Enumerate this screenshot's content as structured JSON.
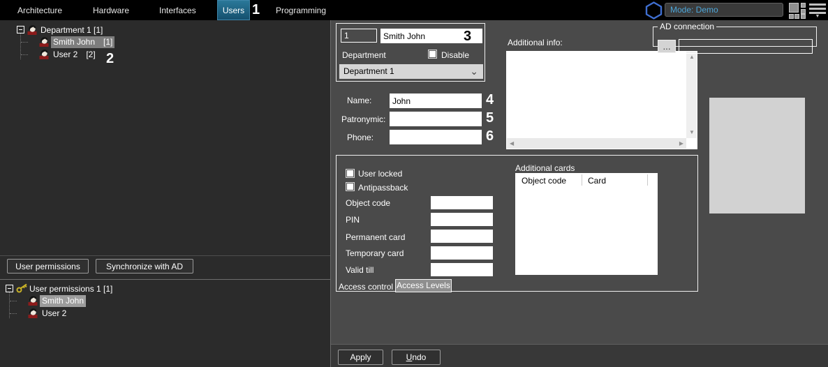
{
  "nav": {
    "items": [
      "Architecture",
      "Hardware",
      "Interfaces",
      "Users",
      "Programming"
    ],
    "mode_text": "Mode: Demo"
  },
  "annotations": {
    "users": "1",
    "smith": "2",
    "fullname": "3",
    "name": "4",
    "patronymic": "5",
    "phone": "6"
  },
  "departments_tree": {
    "root_label": "Department 1 [1]",
    "items": [
      {
        "label": "Smith John",
        "count": "[1]"
      },
      {
        "label": "User 2",
        "count": "[2]"
      }
    ]
  },
  "left_buttons": {
    "user_permissions": "User permissions",
    "synchronize_ad": "Synchronize with AD"
  },
  "permissions_tree": {
    "root_label": "User permissions 1 [1]",
    "items": [
      {
        "label": "Smith John"
      },
      {
        "label": "User 2"
      }
    ]
  },
  "user_form": {
    "id_value": "1",
    "full_name_value": "Smith John",
    "department_label": "Department",
    "disable_label": "Disable",
    "department_value": "Department 1",
    "name_label": "Name:",
    "name_value": "John",
    "patronymic_label": "Patronymic:",
    "patronymic_value": "",
    "phone_label": "Phone:",
    "phone_value": "",
    "additional_info_label": "Additional info:",
    "additional_info_value": "",
    "ad_connection": {
      "legend": "AD connection",
      "browse_label": "...",
      "value": ""
    }
  },
  "access_section": {
    "user_locked_label": "User locked",
    "antipassback_label": "Antipassback",
    "fields": [
      {
        "label": "Object code",
        "value": ""
      },
      {
        "label": "PIN",
        "value": ""
      },
      {
        "label": "Permanent card",
        "value": ""
      },
      {
        "label": "Temporary card",
        "value": ""
      },
      {
        "label": "Valid till",
        "value": ""
      }
    ],
    "additional_cards_label": "Additional cards",
    "cards_columns": [
      "Object code",
      "Card"
    ],
    "tabs": [
      "Access control",
      "Access Levels"
    ]
  },
  "footer": {
    "apply_label": "Apply",
    "undo_label": "Undo"
  },
  "icons": {
    "chevron_down": "⌄",
    "scroll_up": "▲",
    "scroll_down": "▼",
    "scroll_left": "◀",
    "scroll_right": "▶",
    "menu_caret": "▼"
  },
  "colors": {
    "accent_blue": "#2d6f93",
    "mode_text": "#4da6d9",
    "hexagon": "#3f6fd1",
    "key_gold": "#c9b227"
  }
}
